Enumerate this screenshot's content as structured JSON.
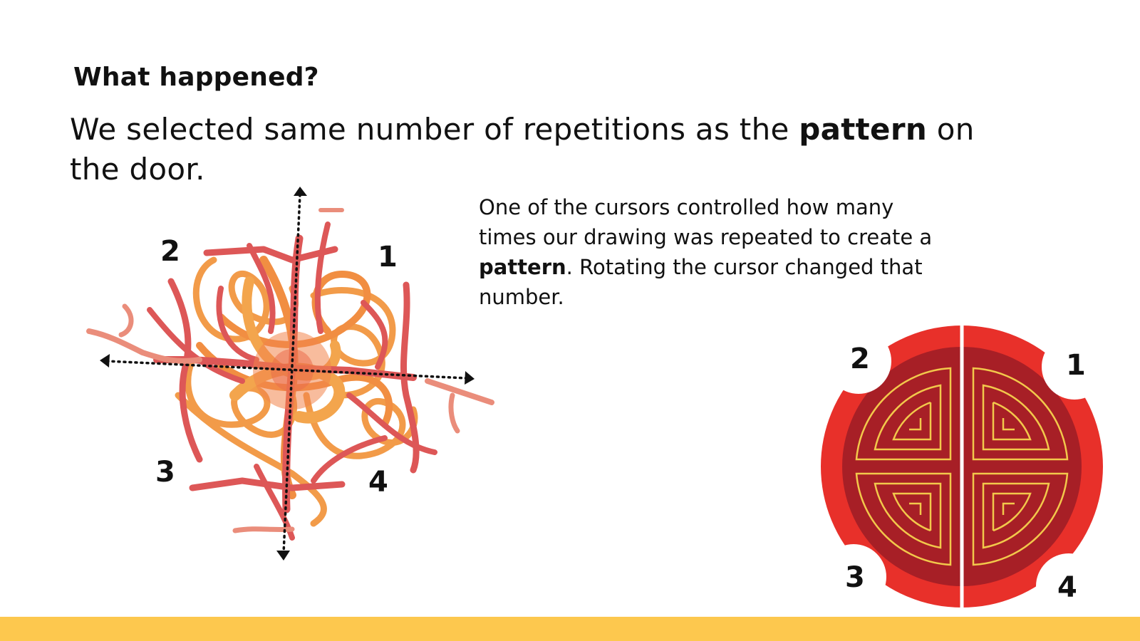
{
  "heading": "What happened?",
  "lead": {
    "part1": "We selected same number of repetitions as the ",
    "bold": "pattern",
    "part2": " on the door."
  },
  "side_text": {
    "part1": "One of the cursors controlled how many times our drawing was repeated to create a ",
    "bold": "pattern",
    "part2": ". Rotating the cursor changed that number."
  },
  "drawing_labels": {
    "q1": "1",
    "q2": "2",
    "q3": "3",
    "q4": "4"
  },
  "door_labels": {
    "q1": "1",
    "q2": "2",
    "q3": "3",
    "q4": "4"
  },
  "colors": {
    "bottom_bar": "#fdc84e",
    "door_outer": "#e8302a",
    "door_inner": "#a71f26",
    "door_pattern": "#f2c84b",
    "scribble_red": "#d83a3a",
    "scribble_orange": "#f08a2a"
  }
}
